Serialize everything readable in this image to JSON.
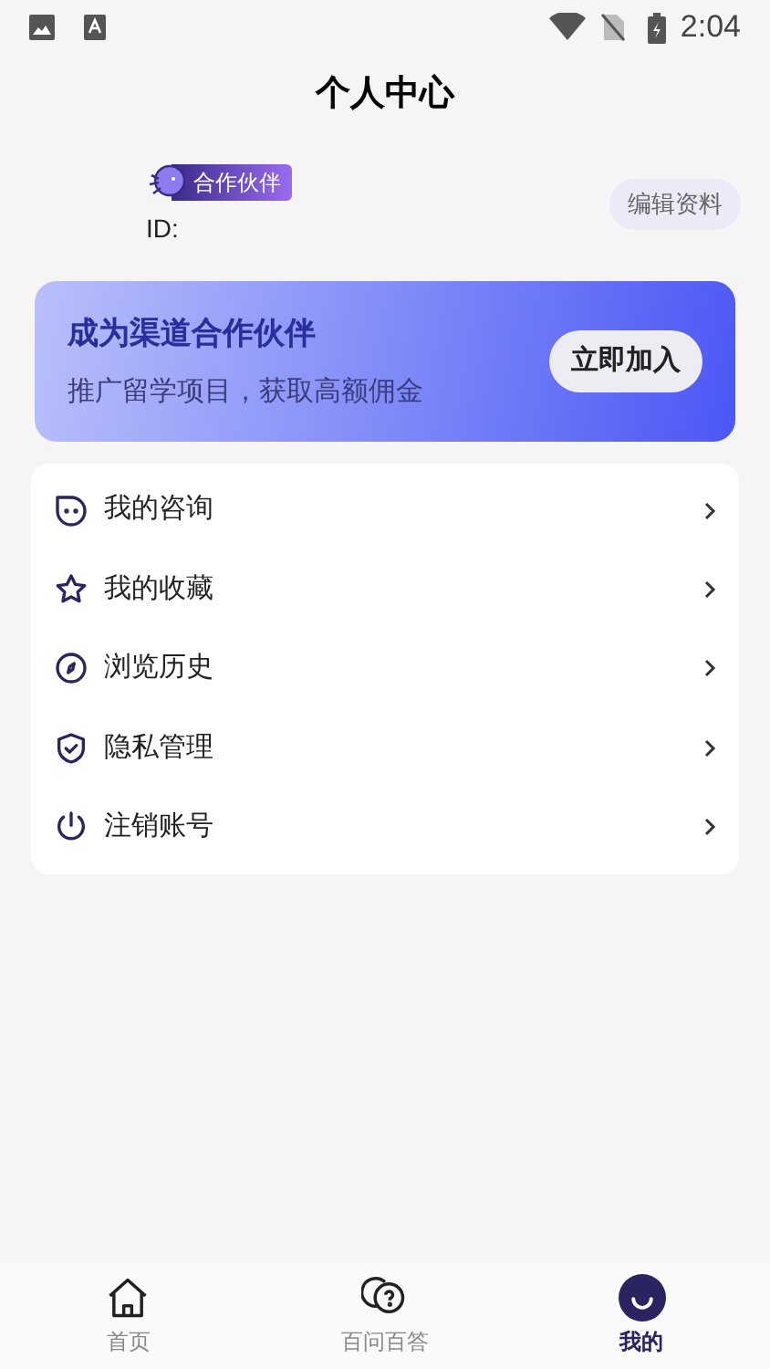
{
  "status_bar": {
    "time": "2:04"
  },
  "title": "个人中心",
  "profile": {
    "badge": "合作伙伴",
    "id_label": "ID:",
    "edit_button": "编辑资料"
  },
  "banner": {
    "title": "成为渠道合作伙伴",
    "subtitle": "推广留学项目，获取高额佣金",
    "button": "立即加入"
  },
  "menu": [
    {
      "kind": "consult",
      "label": "我的咨询"
    },
    {
      "kind": "favorite",
      "label": "我的收藏"
    },
    {
      "kind": "history",
      "label": "浏览历史"
    },
    {
      "kind": "privacy",
      "label": "隐私管理"
    },
    {
      "kind": "logout",
      "label": "注销账号"
    }
  ],
  "tabs": [
    {
      "kind": "home",
      "label": "首页",
      "selected": false
    },
    {
      "kind": "qa",
      "label": "百问百答",
      "selected": false
    },
    {
      "kind": "me",
      "label": "我的",
      "selected": true
    }
  ]
}
